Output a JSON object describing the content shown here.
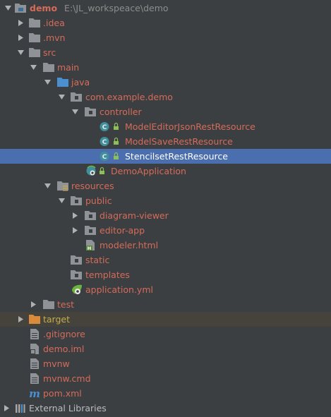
{
  "tree": {
    "root": {
      "name": "demo",
      "path": "E:\\JL_workspeace\\demo"
    },
    "items": [
      {
        "label": ".idea"
      },
      {
        "label": ".mvn"
      },
      {
        "label": "src"
      },
      {
        "label": "main"
      },
      {
        "label": "java"
      },
      {
        "label": "com.example.demo"
      },
      {
        "label": "controller"
      },
      {
        "label": "ModelEditorJsonRestResource"
      },
      {
        "label": "ModelSaveRestResource"
      },
      {
        "label": "StencilsetRestResource"
      },
      {
        "label": "DemoApplication"
      },
      {
        "label": "resources"
      },
      {
        "label": "public"
      },
      {
        "label": "diagram-viewer"
      },
      {
        "label": "editor-app"
      },
      {
        "label": "modeler.html"
      },
      {
        "label": "static"
      },
      {
        "label": "templates"
      },
      {
        "label": "application.yml"
      },
      {
        "label": "test"
      },
      {
        "label": "target"
      },
      {
        "label": ".gitignore"
      },
      {
        "label": "demo.iml"
      },
      {
        "label": "mvnw"
      },
      {
        "label": "mvnw.cmd"
      },
      {
        "label": "pom.xml"
      },
      {
        "label": "External Libraries"
      }
    ]
  },
  "colors": {
    "background": "#3c3f41",
    "selection": "#4b6eaf",
    "excluded_row": "#45433b",
    "modified_text": "#d56b5a",
    "excluded_text": "#c4ad4b",
    "folder": "#8f9398",
    "source_folder": "#4a8fd0",
    "class_badge": "#3f8f9d"
  }
}
